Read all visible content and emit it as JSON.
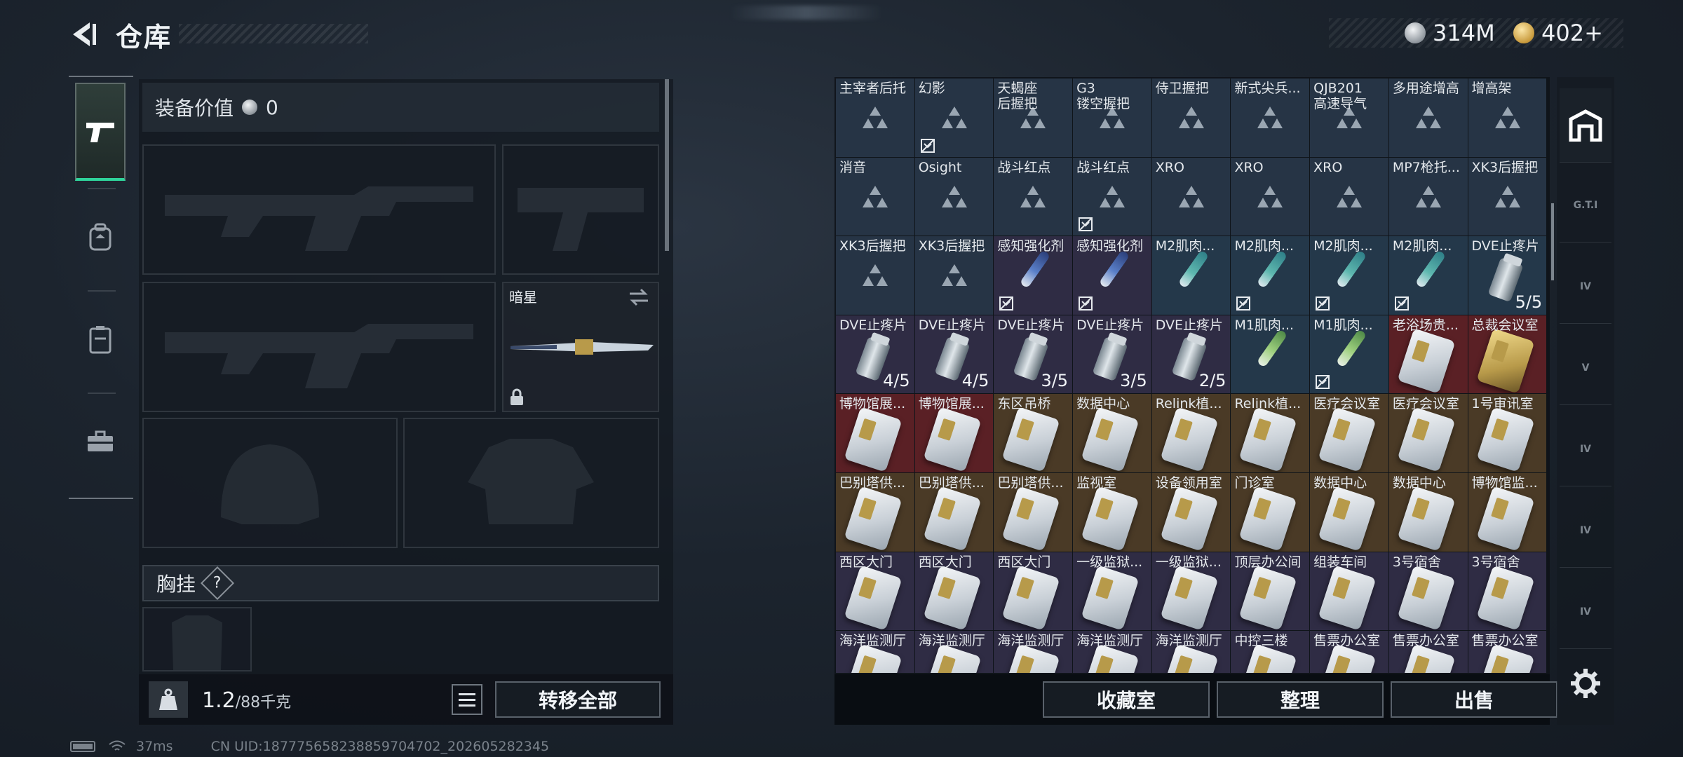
{
  "header": {
    "title": "仓库",
    "currencies": [
      {
        "icon": "silver-coin-icon",
        "amount": "314M"
      },
      {
        "icon": "gold-coin-icon",
        "amount": "402+"
      }
    ]
  },
  "rail": {
    "items": [
      {
        "name": "weapons",
        "icon": "pistol-icon",
        "active": true
      },
      {
        "name": "backpack",
        "icon": "backpack-icon",
        "active": false
      },
      {
        "name": "vest",
        "icon": "chest-rig-icon",
        "active": false
      },
      {
        "name": "case",
        "icon": "briefcase-icon",
        "active": false
      }
    ]
  },
  "loadout": {
    "value_label": "装备价值",
    "value_amount": "0",
    "melee_name": "暗星",
    "vest_label": "胸挂",
    "vest_help": "?",
    "weight_current": "1.2",
    "weight_max": "/88千克",
    "weight_badge": "KG",
    "transfer_all": "转移全部"
  },
  "warehouse": {
    "items": [
      {
        "name": "主宰者后托",
        "bg": "slate",
        "art": "tri"
      },
      {
        "name": "幻影",
        "bg": "slate",
        "art": "tri",
        "nobind": true
      },
      {
        "name": "天蝎座\n后握把",
        "bg": "slate",
        "art": "tri"
      },
      {
        "name": "G3\n镂空握把",
        "bg": "slate",
        "art": "tri"
      },
      {
        "name": "侍卫握把",
        "bg": "slate",
        "art": "tri"
      },
      {
        "name": "新式尖兵...",
        "bg": "slate",
        "art": "tri"
      },
      {
        "name": "QJB201\n高速导气",
        "bg": "slate",
        "art": "tri"
      },
      {
        "name": "多用途增高",
        "bg": "slate",
        "art": "tri"
      },
      {
        "name": "增高架",
        "bg": "slate",
        "art": "tri"
      },
      {
        "name": "消音",
        "bg": "slate",
        "art": "tri"
      },
      {
        "name": "Osight",
        "bg": "slate",
        "art": "tri"
      },
      {
        "name": "战斗红点",
        "bg": "slate",
        "art": "tri"
      },
      {
        "name": "战斗红点",
        "bg": "slate",
        "art": "tri",
        "nobind": true
      },
      {
        "name": "XRO",
        "bg": "slate",
        "art": "tri"
      },
      {
        "name": "XRO",
        "bg": "slate",
        "art": "tri"
      },
      {
        "name": "XRO",
        "bg": "slate",
        "art": "tri"
      },
      {
        "name": "MP7枪托...",
        "bg": "slate",
        "art": "tri"
      },
      {
        "name": "XK3后握把",
        "bg": "slate",
        "art": "tri"
      },
      {
        "name": "XK3后握把",
        "bg": "slate",
        "art": "tri"
      },
      {
        "name": "XK3后握把",
        "bg": "slate",
        "art": "tri"
      },
      {
        "name": "感知强化剂",
        "bg": "purple",
        "art": "syringe-blue",
        "nobind": true
      },
      {
        "name": "感知强化剂",
        "bg": "purple",
        "art": "syringe-blue",
        "nobind": true
      },
      {
        "name": "M2肌肉...",
        "bg": "teal",
        "art": "syringe"
      },
      {
        "name": "M2肌肉...",
        "bg": "teal",
        "art": "syringe",
        "nobind": true
      },
      {
        "name": "M2肌肉...",
        "bg": "teal",
        "art": "syringe",
        "nobind": true
      },
      {
        "name": "M2肌肉...",
        "bg": "teal",
        "art": "syringe",
        "nobind": true
      },
      {
        "name": "DVE止疼片",
        "bg": "teal",
        "art": "bottle",
        "qty": "5/5"
      },
      {
        "name": "DVE止疼片",
        "bg": "purple",
        "art": "bottle",
        "qty": "4/5"
      },
      {
        "name": "DVE止疼片",
        "bg": "purple",
        "art": "bottle",
        "qty": "4/5"
      },
      {
        "name": "DVE止疼片",
        "bg": "purple",
        "art": "bottle",
        "qty": "3/5"
      },
      {
        "name": "DVE止疼片",
        "bg": "purple",
        "art": "bottle",
        "qty": "3/5"
      },
      {
        "name": "DVE止疼片",
        "bg": "purple",
        "art": "bottle",
        "qty": "2/5"
      },
      {
        "name": "M1肌肉...",
        "bg": "teal",
        "art": "syringe-green"
      },
      {
        "name": "M1肌肉...",
        "bg": "teal",
        "art": "syringe-green",
        "nobind": true
      },
      {
        "name": "老浴场贵...",
        "bg": "red",
        "art": "keycard"
      },
      {
        "name": "总裁会议室",
        "bg": "red",
        "art": "keycard-gold"
      },
      {
        "name": "博物馆展...",
        "bg": "red",
        "art": "keycard"
      },
      {
        "name": "博物馆展...",
        "bg": "red",
        "art": "keycard"
      },
      {
        "name": "东区吊桥",
        "bg": "gold",
        "art": "keycard"
      },
      {
        "name": "数据中心",
        "bg": "gold",
        "art": "keycard"
      },
      {
        "name": "Relink植...",
        "bg": "gold",
        "art": "keycard"
      },
      {
        "name": "Relink植...",
        "bg": "gold",
        "art": "keycard"
      },
      {
        "name": "医疗会议室",
        "bg": "gold",
        "art": "keycard"
      },
      {
        "name": "医疗会议室",
        "bg": "gold",
        "art": "keycard"
      },
      {
        "name": "1号审讯室",
        "bg": "gold",
        "art": "keycard"
      },
      {
        "name": "巴别塔供...",
        "bg": "gold",
        "art": "keycard"
      },
      {
        "name": "巴别塔供...",
        "bg": "gold",
        "art": "keycard"
      },
      {
        "name": "巴别塔供...",
        "bg": "gold",
        "art": "keycard"
      },
      {
        "name": "监视室",
        "bg": "gold",
        "art": "keycard"
      },
      {
        "name": "设备领用室",
        "bg": "gold",
        "art": "keycard"
      },
      {
        "name": "门诊室",
        "bg": "gold",
        "art": "keycard"
      },
      {
        "name": "数据中心",
        "bg": "gold",
        "art": "keycard"
      },
      {
        "name": "数据中心",
        "bg": "gold",
        "art": "keycard"
      },
      {
        "name": "博物馆监...",
        "bg": "gold",
        "art": "keycard"
      },
      {
        "name": "西区大门",
        "bg": "purple",
        "art": "keycard"
      },
      {
        "name": "西区大门",
        "bg": "purple",
        "art": "keycard"
      },
      {
        "name": "西区大门",
        "bg": "purple",
        "art": "keycard"
      },
      {
        "name": "一级监狱...",
        "bg": "purple",
        "art": "keycard"
      },
      {
        "name": "一级监狱...",
        "bg": "purple",
        "art": "keycard"
      },
      {
        "name": "顶层办公间",
        "bg": "purple",
        "art": "keycard"
      },
      {
        "name": "组装车间",
        "bg": "purple",
        "art": "keycard"
      },
      {
        "name": "3号宿舍",
        "bg": "purple",
        "art": "keycard"
      },
      {
        "name": "3号宿舍",
        "bg": "purple",
        "art": "keycard"
      },
      {
        "name": "海洋监测厅",
        "bg": "purple",
        "art": "keycard"
      },
      {
        "name": "海洋监测厅",
        "bg": "purple",
        "art": "keycard"
      },
      {
        "name": "海洋监测厅",
        "bg": "purple",
        "art": "keycard"
      },
      {
        "name": "海洋监测厅",
        "bg": "purple",
        "art": "keycard"
      },
      {
        "name": "海洋监测厅",
        "bg": "purple",
        "art": "keycard"
      },
      {
        "name": "中控三楼",
        "bg": "purple",
        "art": "keycard"
      },
      {
        "name": "售票办公室",
        "bg": "purple",
        "art": "keycard"
      },
      {
        "name": "售票办公室",
        "bg": "purple",
        "art": "keycard"
      },
      {
        "name": "售票办公室",
        "bg": "purple",
        "art": "keycard"
      }
    ],
    "collect_label": "收藏室",
    "sort_label": "整理",
    "sell_label": "出售"
  },
  "right_tabs": [
    {
      "label": "",
      "icon": "warehouse-icon",
      "active": true
    },
    {
      "label": "G.T.I",
      "icon": "storage-rack-icon"
    },
    {
      "label": "IV",
      "icon": "storage-rack-icon"
    },
    {
      "label": "V",
      "icon": "storage-rack-icon"
    },
    {
      "label": "IV",
      "icon": "storage-rack-icon"
    },
    {
      "label": "IV",
      "icon": "storage-rack-icon"
    },
    {
      "label": "IV",
      "icon": "storage-rack-icon"
    }
  ],
  "status": {
    "ping": "37ms",
    "uid": "CN UID:18777565823885970470​2_202605282345"
  },
  "colors": {
    "accent_green": "#2fd39a",
    "rarity_red": "#5a2025",
    "rarity_gold": "#4a3a26",
    "rarity_purple": "#2f2c44"
  }
}
